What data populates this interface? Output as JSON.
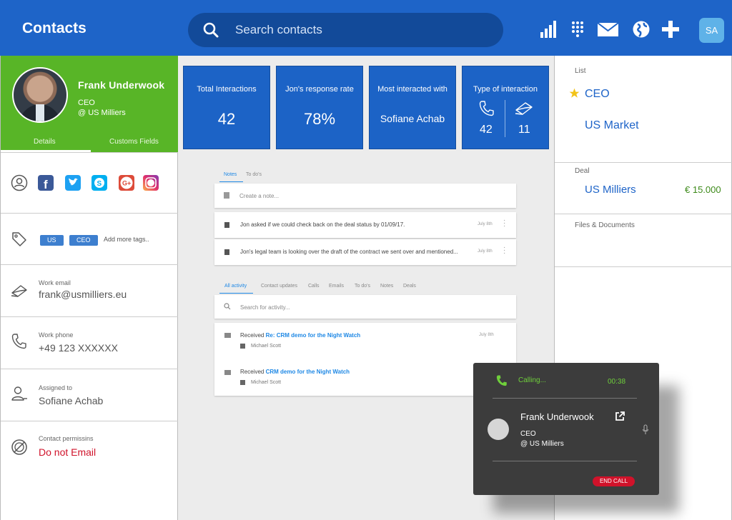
{
  "header": {
    "title": "Contacts",
    "search_placeholder": "Search contacts",
    "icons": [
      "bar-chart-icon",
      "dialpad-icon",
      "mail-icon",
      "globe-icon",
      "plus-icon"
    ],
    "user_initials": "SA",
    "color": "#1e64c8"
  },
  "profile": {
    "name": "Frank Underwook",
    "role": "CEO",
    "company": "@ US Milliers",
    "tabs": [
      "Details",
      "Customs Fields"
    ],
    "accent": "#58b527"
  },
  "details": {
    "social": [
      "facebook-icon",
      "twitter-icon",
      "skype-icon",
      "google-plus-icon",
      "instagram-icon"
    ],
    "tags": [
      "US",
      "CEO"
    ],
    "add_tags": "Add more tags..",
    "work_email_label": "Work email",
    "work_email": "frank@usmilliers.eu",
    "work_phone_label": "Work phone",
    "work_phone": "+49 123 XXXXXX",
    "assigned_label": "Assigned to",
    "assigned": "Sofiane Achab",
    "permission_label": "Contact permissins",
    "permission": "Do not Email"
  },
  "kpis": {
    "total_label": "Total Interactions",
    "total_value": "42",
    "rate_label": "Jon's response rate",
    "rate_value": "78%",
    "most_label": "Most interacted with",
    "most_value": "Sofiane Achab",
    "type_label": "Type of interaction",
    "calls": "42",
    "emails": "11"
  },
  "notes": {
    "tabs": [
      "Notes",
      "To do's"
    ],
    "placeholder": "Create a note...",
    "items": [
      {
        "text": "Jon asked if we could check back on the deal status by 01/09/17.",
        "date": "July 8th"
      },
      {
        "text": "Jon's legal team is looking over the draft of the contract we sent over and mentioned...",
        "date": "July 8th"
      }
    ]
  },
  "activity": {
    "tabs": [
      "All activity",
      "Contact updates",
      "Calls",
      "Emails",
      "To do's",
      "Notes",
      "Deals"
    ],
    "search_placeholder": "Search for activity...",
    "items": [
      {
        "prefix": "Received",
        "link": "Re: CRM demo for the Night Watch",
        "user": "Michael Scott",
        "date": "July 8th"
      },
      {
        "prefix": "Received",
        "link": "CRM demo for the Night Watch",
        "user": "Michael Scott",
        "date": ""
      }
    ]
  },
  "right": {
    "list_label": "List",
    "lists": [
      "CEO",
      "US Market"
    ],
    "deal_label": "Deal",
    "deal_name": "US Milliers",
    "deal_value": "€ 15.000",
    "files_label": "Files & Documents"
  },
  "call": {
    "status": "Calling...",
    "timer": "00:38",
    "name": "Frank Underwook",
    "role": "CEO",
    "company": "@ US Milliers",
    "end_label": "END CALL"
  }
}
